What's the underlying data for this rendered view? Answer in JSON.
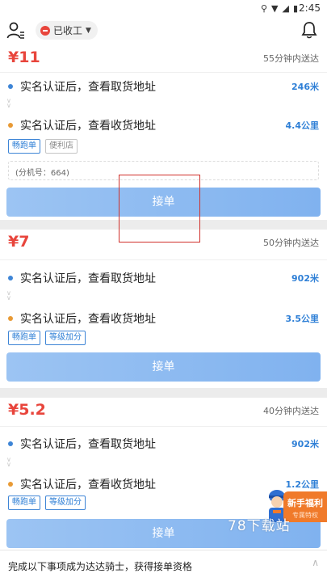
{
  "statusbar": {
    "time": "2:45",
    "icons": [
      "location-icon",
      "wifi-icon",
      "signal-icon",
      "battery-icon"
    ]
  },
  "header": {
    "status_label": "已收工"
  },
  "orders": [
    {
      "price": "¥11",
      "eta": "55分钟内送达",
      "pickup": {
        "text": "实名认证后，查看取货地址",
        "distance": "246米"
      },
      "dropoff": {
        "text": "实名认证后，查看收货地址",
        "distance": "4.4公里"
      },
      "tags": [
        "畅跑单",
        "便利店"
      ],
      "note": "(分机号：664)",
      "accept": "接单"
    },
    {
      "price": "¥7",
      "eta": "50分钟内送达",
      "pickup": {
        "text": "实名认证后，查看取货地址",
        "distance": "902米"
      },
      "dropoff": {
        "text": "实名认证后，查看收货地址",
        "distance": "3.5公里"
      },
      "tags": [
        "畅跑单",
        "等级加分"
      ],
      "accept": "接单"
    },
    {
      "price": "¥5.2",
      "eta": "40分钟内送达",
      "pickup": {
        "text": "实名认证后，查看取货地址",
        "distance": "902米"
      },
      "dropoff": {
        "text": "实名认证后，查看收货地址",
        "distance": "1.2公里"
      },
      "tags": [
        "畅跑单",
        "等级加分"
      ],
      "accept": "接单"
    }
  ],
  "promo": {
    "title": "新手福利",
    "subtitle": "专属特权"
  },
  "watermark": "78下载站",
  "footer": {
    "message": "完成以下事项成为达达骑士，获得接单资格"
  },
  "colors": {
    "price": "#e8453c",
    "accent": "#2e7fd6",
    "button": "#80b2ef",
    "highlight_box": "#d0302b",
    "promo": "#f07a2a"
  }
}
